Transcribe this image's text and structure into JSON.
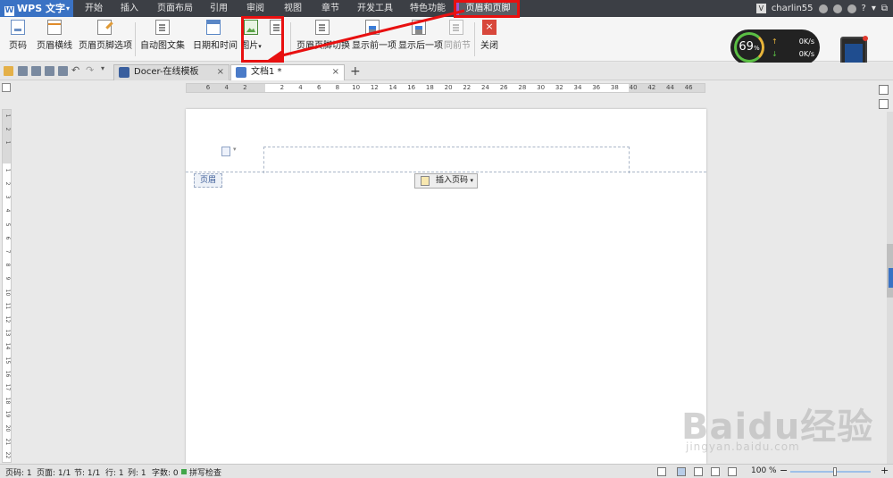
{
  "app": {
    "name": "WPS 文字"
  },
  "menu_tabs": [
    "开始",
    "插入",
    "页面布局",
    "引用",
    "审阅",
    "视图",
    "章节",
    "开发工具",
    "特色功能",
    "页眉和页脚"
  ],
  "active_tab": "页眉和页脚",
  "user": {
    "name": "charlin55",
    "avatar_letter": "V"
  },
  "ribbon": {
    "page_number": "页码",
    "header_line": "页眉横线",
    "header_footer_options": "页眉页脚选项",
    "auto_text": "自动图文集",
    "date_time": "日期和时间",
    "picture": "图片",
    "switch_header_footer": "页眉页脚切换",
    "show_previous": "显示前一项",
    "show_next": "显示后一项",
    "same_as_previous": "同前节",
    "close": "关闭"
  },
  "system_monitor": {
    "percent": "69",
    "unit": "%",
    "upload": "0K/s",
    "download": "0K/s"
  },
  "doc_tabs": [
    {
      "label": "Docer-在线模板",
      "close": "×"
    },
    {
      "label": "文档1 *",
      "close": "×"
    }
  ],
  "new_tab": "+",
  "ruler_h": [
    "6",
    "4",
    "2",
    "",
    "2",
    "4",
    "6",
    "8",
    "10",
    "12",
    "14",
    "16",
    "18",
    "20",
    "22",
    "24",
    "26",
    "28",
    "30",
    "32",
    "34",
    "36",
    "38",
    "40",
    "42",
    "44",
    "46"
  ],
  "ruler_v": [
    "1",
    "2",
    "1",
    "",
    "1",
    "2",
    "3",
    "4",
    "5",
    "6",
    "7",
    "8",
    "9",
    "10",
    "11",
    "12",
    "13",
    "14",
    "15",
    "16",
    "17",
    "18",
    "19",
    "20",
    "21",
    "22",
    "23"
  ],
  "page": {
    "header_label": "页眉",
    "insert_page_number": "插入页码"
  },
  "statusbar": {
    "page_code": "页码: 1",
    "page": "页面: 1/1",
    "section": "节: 1/1",
    "row": "行: 1",
    "col": "列: 1",
    "word_count": "字数: 0",
    "spell_check": "拼写检查",
    "zoom": "100 %",
    "zoom_minus": "−",
    "zoom_plus": "+"
  },
  "watermark": {
    "text": "Baidu经验",
    "url": "jingyan.baidu.com"
  },
  "colors": {
    "highlight_box": "#e81010",
    "accent": "#3a72c4",
    "tab_bar": "#3c3f45"
  }
}
